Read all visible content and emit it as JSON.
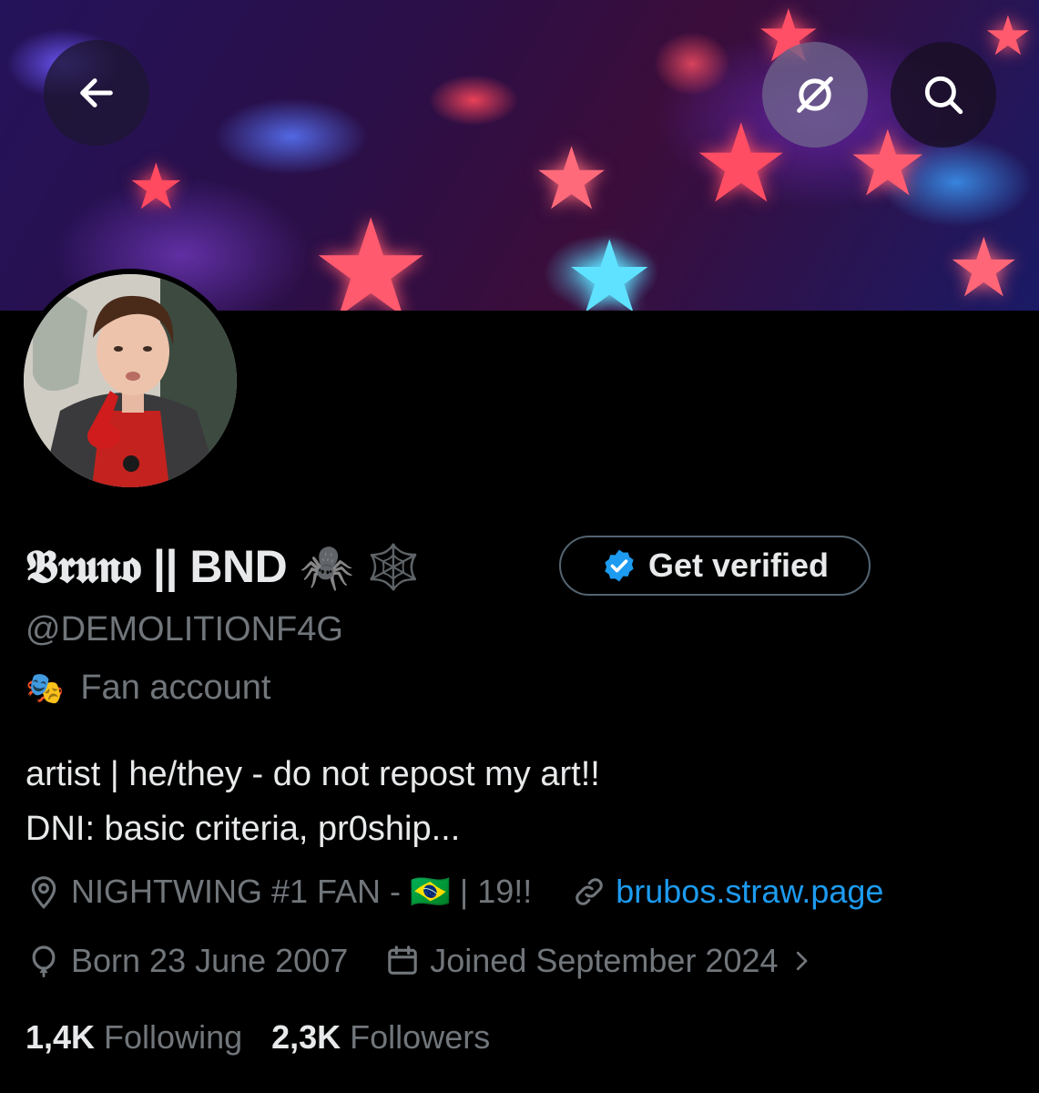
{
  "header": {
    "back_icon": "arrow-left-icon",
    "grok_icon": "grok-icon",
    "search_icon": "search-icon",
    "banner_colors": [
      "#24135a",
      "#ff4a5e",
      "#5a78ff",
      "#5ad6ff"
    ]
  },
  "profile": {
    "display_name": "𝕭𝖗𝖚𝖓𝖔 || BND",
    "name_emojis": "🕷️ 🕸️",
    "get_verified_label": "Get verified",
    "handle": "@DEMOLITIONF4G",
    "category_emoji": "🎭",
    "category": "Fan account",
    "bio_line1": "artist | he/they - do not repost my art!!",
    "bio_line2": "DNI: basic criteria, pr0ship...",
    "location": "NIGHTWING #1 FAN - 🇧🇷 | 19!!",
    "website": "brubos.straw.page",
    "birthday": "Born 23 June 2007",
    "joined": "Joined September 2024",
    "following_count": "1,4K",
    "following_label": "Following",
    "followers_count": "2,3K",
    "followers_label": "Followers"
  },
  "colors": {
    "background": "#000000",
    "text": "#e7e9ea",
    "secondary": "#71767b",
    "link": "#1d9bf0",
    "border": "#536471"
  }
}
